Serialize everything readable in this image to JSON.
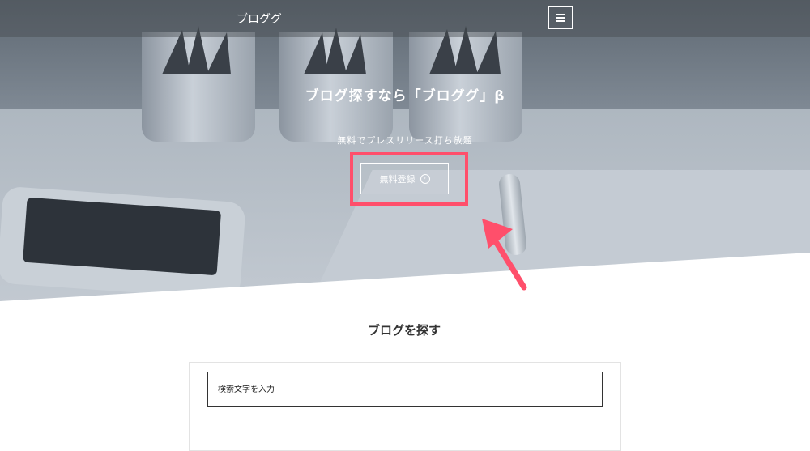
{
  "nav": {
    "logo": "ブロググ",
    "menu_icon": "hamburger-menu-icon"
  },
  "hero": {
    "title": "ブログ探すなら「ブロググ」β",
    "subtitle": "無料でプレスリリース打ち放題",
    "cta_label": "無料登録",
    "cta_icon": "circle-chevron-right-icon",
    "highlight_color": "#ff4f6b"
  },
  "section": {
    "title": "ブログを探す",
    "search_placeholder": "検索文字を入力"
  }
}
